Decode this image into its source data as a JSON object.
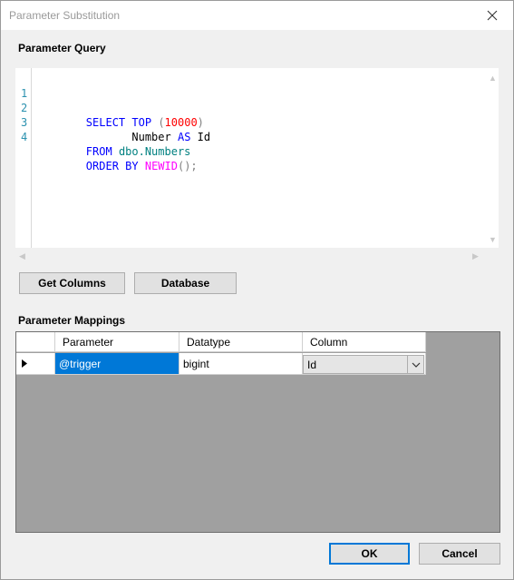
{
  "window": {
    "title": "Parameter Substitution"
  },
  "query_section": {
    "label": "Parameter Query",
    "lines": [
      {
        "number": "1",
        "tokens": [
          "SELECT",
          " ",
          "TOP",
          " ",
          "(",
          "10000",
          ")"
        ]
      },
      {
        "number": "2",
        "tokens": [
          "       ",
          "Number",
          " ",
          "AS",
          " ",
          "Id"
        ]
      },
      {
        "number": "3",
        "tokens": [
          "FROM",
          " ",
          "dbo.Numbers"
        ]
      },
      {
        "number": "4",
        "tokens": [
          "ORDER",
          " ",
          "BY",
          " ",
          "NEWID",
          "();"
        ]
      }
    ]
  },
  "buttons": {
    "get_columns": "Get Columns",
    "database": "Database",
    "ok": "OK",
    "cancel": "Cancel"
  },
  "mappings_section": {
    "label": "Parameter Mappings",
    "columns": [
      "Parameter",
      "Datatype",
      "Column"
    ],
    "rows": [
      {
        "row_indicator": "▶",
        "parameter": "@trigger",
        "datatype": "bigint",
        "column": "Id"
      }
    ]
  },
  "colors": {
    "keyword": "#0000ff",
    "function": "#ff00ff",
    "object": "#008080",
    "number": "#ff0000",
    "selection": "#0078d7",
    "grid_background": "#a0a0a0"
  },
  "icons": {
    "close": "close-icon",
    "dropdown": "chevron-down-icon",
    "row_indicator": "row-pointer-icon"
  }
}
